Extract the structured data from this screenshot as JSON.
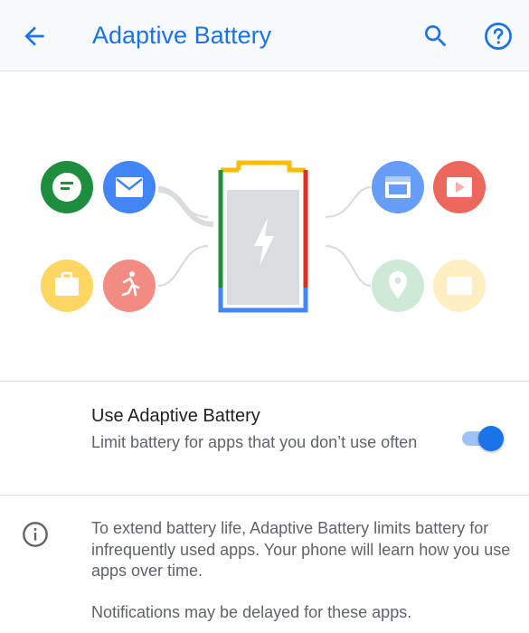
{
  "app_bar": {
    "title": "Adaptive Battery",
    "back_icon": "arrow-back-icon",
    "search_icon": "search-icon",
    "help_icon": "help-icon",
    "accent_color": "#1a73e8"
  },
  "illustration": {
    "left_apps": [
      {
        "icon": "messages-icon",
        "color": "#1e8e3e"
      },
      {
        "icon": "email-icon",
        "color": "#4285f4"
      },
      {
        "icon": "briefcase-icon",
        "color": "#fdd663"
      },
      {
        "icon": "fitness-icon",
        "color": "#f28b82"
      }
    ],
    "right_apps": [
      {
        "icon": "calendar-icon",
        "color": "#669df6"
      },
      {
        "icon": "video-icon",
        "color": "#ee675c"
      },
      {
        "icon": "maps-icon",
        "color": "#ceead6"
      },
      {
        "icon": "card-icon",
        "color": "#feefc3"
      }
    ],
    "battery_icon": "battery-icon",
    "bolt_icon": "lightning-bolt-icon"
  },
  "setting": {
    "title": "Use Adaptive Battery",
    "summary": "Limit battery for apps that you don’t use often",
    "enabled": true
  },
  "info": {
    "icon": "info-icon",
    "text": "To extend battery life, Adaptive Battery limits battery for infrequently used apps. Your phone will learn how you use apps over time.",
    "note": "Notifications may be delayed for these apps."
  }
}
